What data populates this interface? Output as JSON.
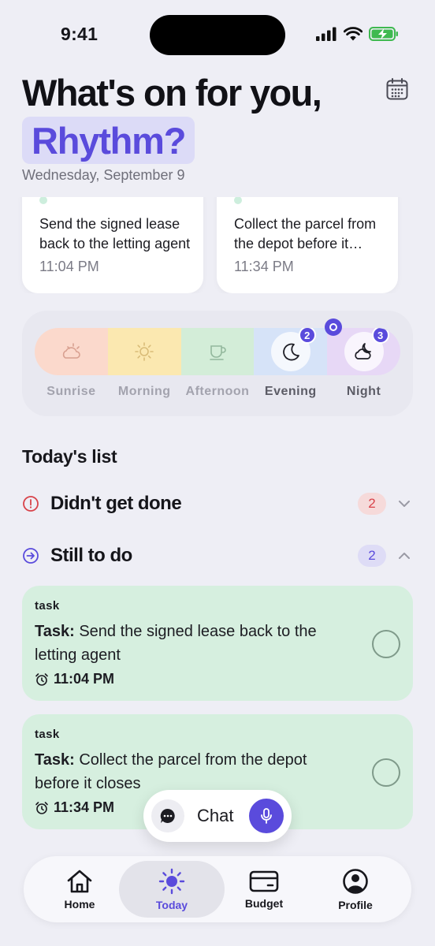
{
  "status_bar": {
    "time": "9:41"
  },
  "header": {
    "headline": "What's on for you,",
    "name": "Rhythm?",
    "date": "Wednesday, September 9",
    "calendar_icon": "calendar-icon"
  },
  "cards": [
    {
      "title": "Send the signed lease back to the letting agent",
      "time": "11:04 PM"
    },
    {
      "title": "Collect the parcel from the depot before it closes",
      "time": "11:34 PM"
    }
  ],
  "time_of_day": {
    "segments": [
      {
        "label": "Sunrise",
        "icon": "sunrise-icon",
        "color": "#fbd9cc"
      },
      {
        "label": "Morning",
        "icon": "sun-icon",
        "color": "#fbe8b0"
      },
      {
        "label": "Afternoon",
        "icon": "cup-icon",
        "color": "#d3edd8"
      },
      {
        "label": "Evening",
        "icon": "moon-icon",
        "color": "#d6e3f8",
        "badge": "2"
      },
      {
        "label": "Night",
        "icon": "cloud-moon-icon",
        "color": "#e7d8f6",
        "badge": "3"
      }
    ]
  },
  "list": {
    "title": "Today's list",
    "overdue": {
      "label": "Didn't get done",
      "count": "2",
      "icon": "alert-circle-icon"
    },
    "todo": {
      "label": "Still to do",
      "count": "2",
      "icon": "arrow-circle-icon"
    },
    "tasks": [
      {
        "kind": "task",
        "prefix": "Task:",
        "title": "Send the signed lease back to the letting agent",
        "time": "11:04 PM"
      },
      {
        "kind": "task",
        "prefix": "Task:",
        "title": "Collect the parcel from the depot before it closes",
        "time": "11:34 PM"
      }
    ]
  },
  "chat": {
    "label": "Chat"
  },
  "tabs": [
    {
      "label": "Home",
      "icon": "home-icon"
    },
    {
      "label": "Today",
      "icon": "sun-icon"
    },
    {
      "label": "Budget",
      "icon": "card-icon"
    },
    {
      "label": "Profile",
      "icon": "profile-icon"
    }
  ],
  "colors": {
    "accent": "#5a4bdc",
    "task_bg": "#d6efdf",
    "danger": "#d8434a"
  }
}
